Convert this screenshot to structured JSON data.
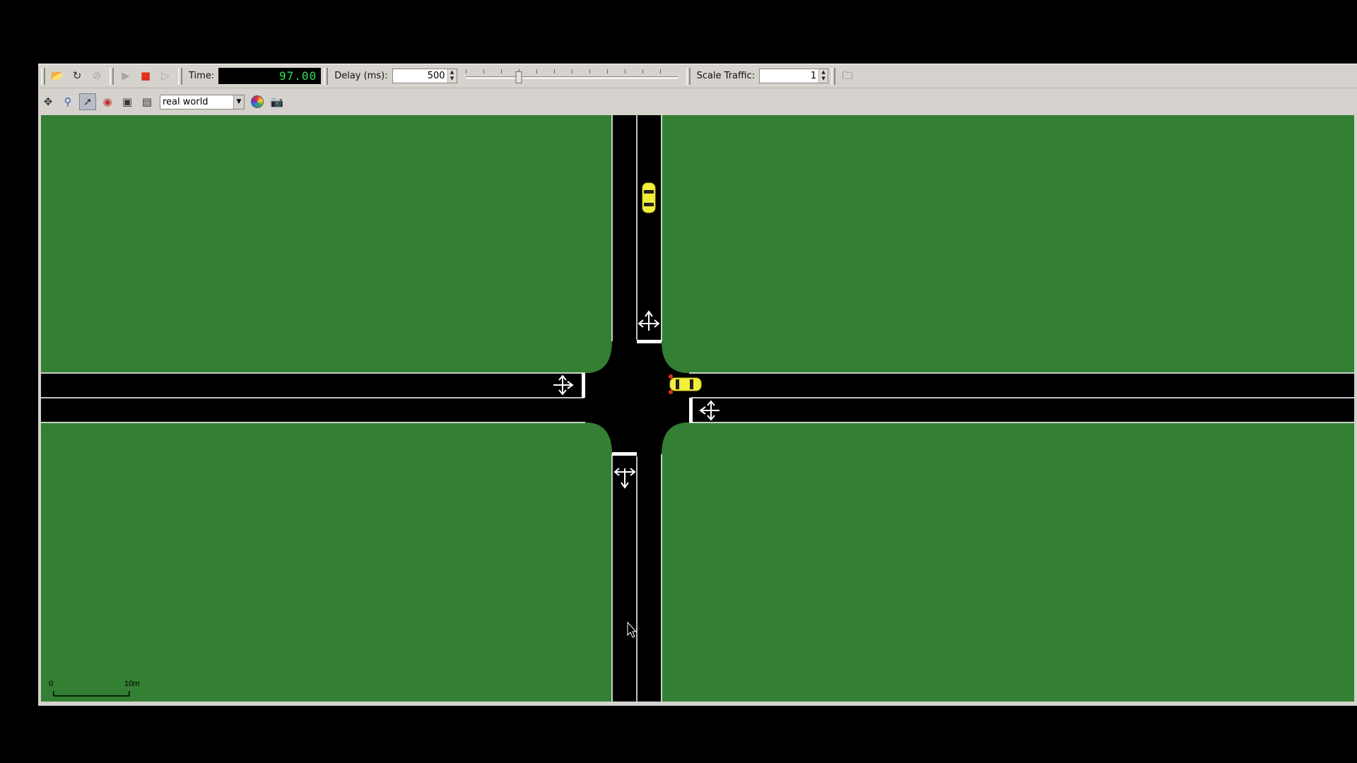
{
  "toolbar": {
    "open_icon": "folder-open-icon",
    "reload_icon": "reload-icon",
    "close_icon": "close-network-icon",
    "play_icon": "play-icon",
    "stop_icon": "stop-icon",
    "step_icon": "step-icon",
    "time_label": "Time:",
    "time_value": "97.00",
    "delay_label": "Delay (ms):",
    "delay_value": "500",
    "delay_slider_fraction": 0.25,
    "scale_label": "Scale Traffic:",
    "scale_value": "1",
    "window_icon": "new-window-icon"
  },
  "view_toolbar": {
    "move_icon": "move-icon",
    "zoom_icon": "zoom-icon",
    "select_icon": "select-icon",
    "locate_icon": "locate-icon",
    "editor_icon": "edit-breakpoints-icon",
    "settings_icon": "view-settings-icon",
    "scheme_value": "real world",
    "colors_icon": "color-wheel-icon",
    "screenshot_icon": "screenshot-icon"
  },
  "map": {
    "scale_start": "0",
    "scale_end": "10m",
    "colors": {
      "grass": "#337f33",
      "road": "#000000",
      "lane_marking": "#ffffff",
      "vehicle": "#f2ee3c"
    }
  }
}
